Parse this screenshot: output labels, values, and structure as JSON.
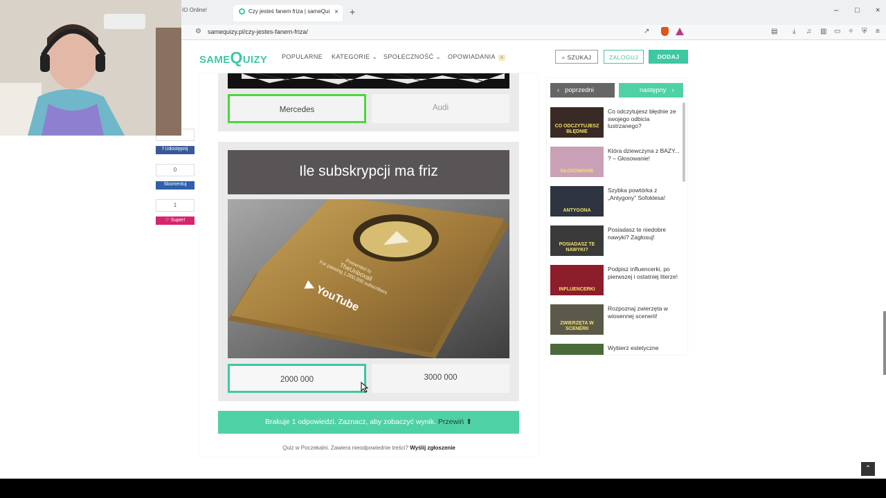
{
  "browser": {
    "prev_tab_title": "IO Online!",
    "active_tab_title": "Czy jesteś fanem friza | sameQui",
    "tab_close": "×",
    "new_tab": "+",
    "url": "samequizy.pl/czy-jestes-fanem-friza/",
    "window_controls": [
      "–",
      "□",
      "×"
    ]
  },
  "site": {
    "logo_same": "SAME",
    "logo_q": "Q",
    "logo_uizy": "UIZY",
    "nav": [
      "POPULARNE",
      "KATEGORIE ⌄",
      "SPOŁECZNOŚĆ ⌄",
      "OPOWIADANIA"
    ],
    "nav_badge": "4",
    "search_label": "SZUKAJ",
    "login_label": "ZALOGUJ",
    "add_label": "DODAJ"
  },
  "quiz": {
    "prev_question": {
      "answers": [
        "Mercedes",
        "Audi"
      ]
    },
    "question": {
      "title": "Ile subskrypcji ma friz",
      "image_label_line1": "Presented to",
      "image_label_line2": "TheUnboxall",
      "image_label_line3": "For passing 1,000,000 subscribers",
      "image_brand": "YouTube",
      "answers": [
        "2000 000",
        "3000 000"
      ]
    },
    "result_bar_text": "Brakuje 1 odpowiedzi. Zaznacz, aby zobaczyć wynik.",
    "result_bar_cta": "Przewiń ⬆",
    "report_text": "Quiz w Poczekalni. Zawiera nieodpowiednie treści?",
    "report_link": "Wyślij zgłoszenie"
  },
  "share": {
    "fb_label": "Udostępnij",
    "comment_count": "0",
    "comment_label": "Skomentuj",
    "super_count": "1",
    "super_label": "Super!"
  },
  "sidebar": {
    "prev_label": "poprzedni",
    "next_label": "następny",
    "items": [
      {
        "title": "Co odczytujesz błędnie ze swojego odbicia lustrzanego?",
        "thumb_text": "CO ODCZYTUJESZ BŁĘDNIE",
        "color": "#3a2a25"
      },
      {
        "title": "Która dziewczyna z BAZY... ? – Głosowanie!",
        "thumb_text": "GŁOSOWANIE",
        "color": "#c9a0b6"
      },
      {
        "title": "Szybka powtórka z „Antygony” Sofoklesa!",
        "thumb_text": "ANTYGONA",
        "color": "#2e3440"
      },
      {
        "title": "Posiadasz te niedobre nawyki? Zagłosuj!",
        "thumb_text": "POSIADASZ TE NAWYKI?",
        "color": "#3a3a3a"
      },
      {
        "title": "Podpisz influencerki, po pierwszej i ostatniej literze!",
        "thumb_text": "INFLUENCERKI",
        "color": "#8c1d2a"
      },
      {
        "title": "Rozpoznaj zwierzęta w wiosennej scenerii!",
        "thumb_text": "ZWIERZĘTA W SCENERII",
        "color": "#5b5a4a"
      },
      {
        "title": "Wybierz estetyczne",
        "thumb_text": "",
        "color": "#4a6a3a"
      }
    ]
  },
  "colors": {
    "accent": "#3ec7a2",
    "selected_border_green": "#4bd63d",
    "facebook": "#3b5998",
    "comment": "#2f5fa8",
    "super": "#d6246e"
  }
}
